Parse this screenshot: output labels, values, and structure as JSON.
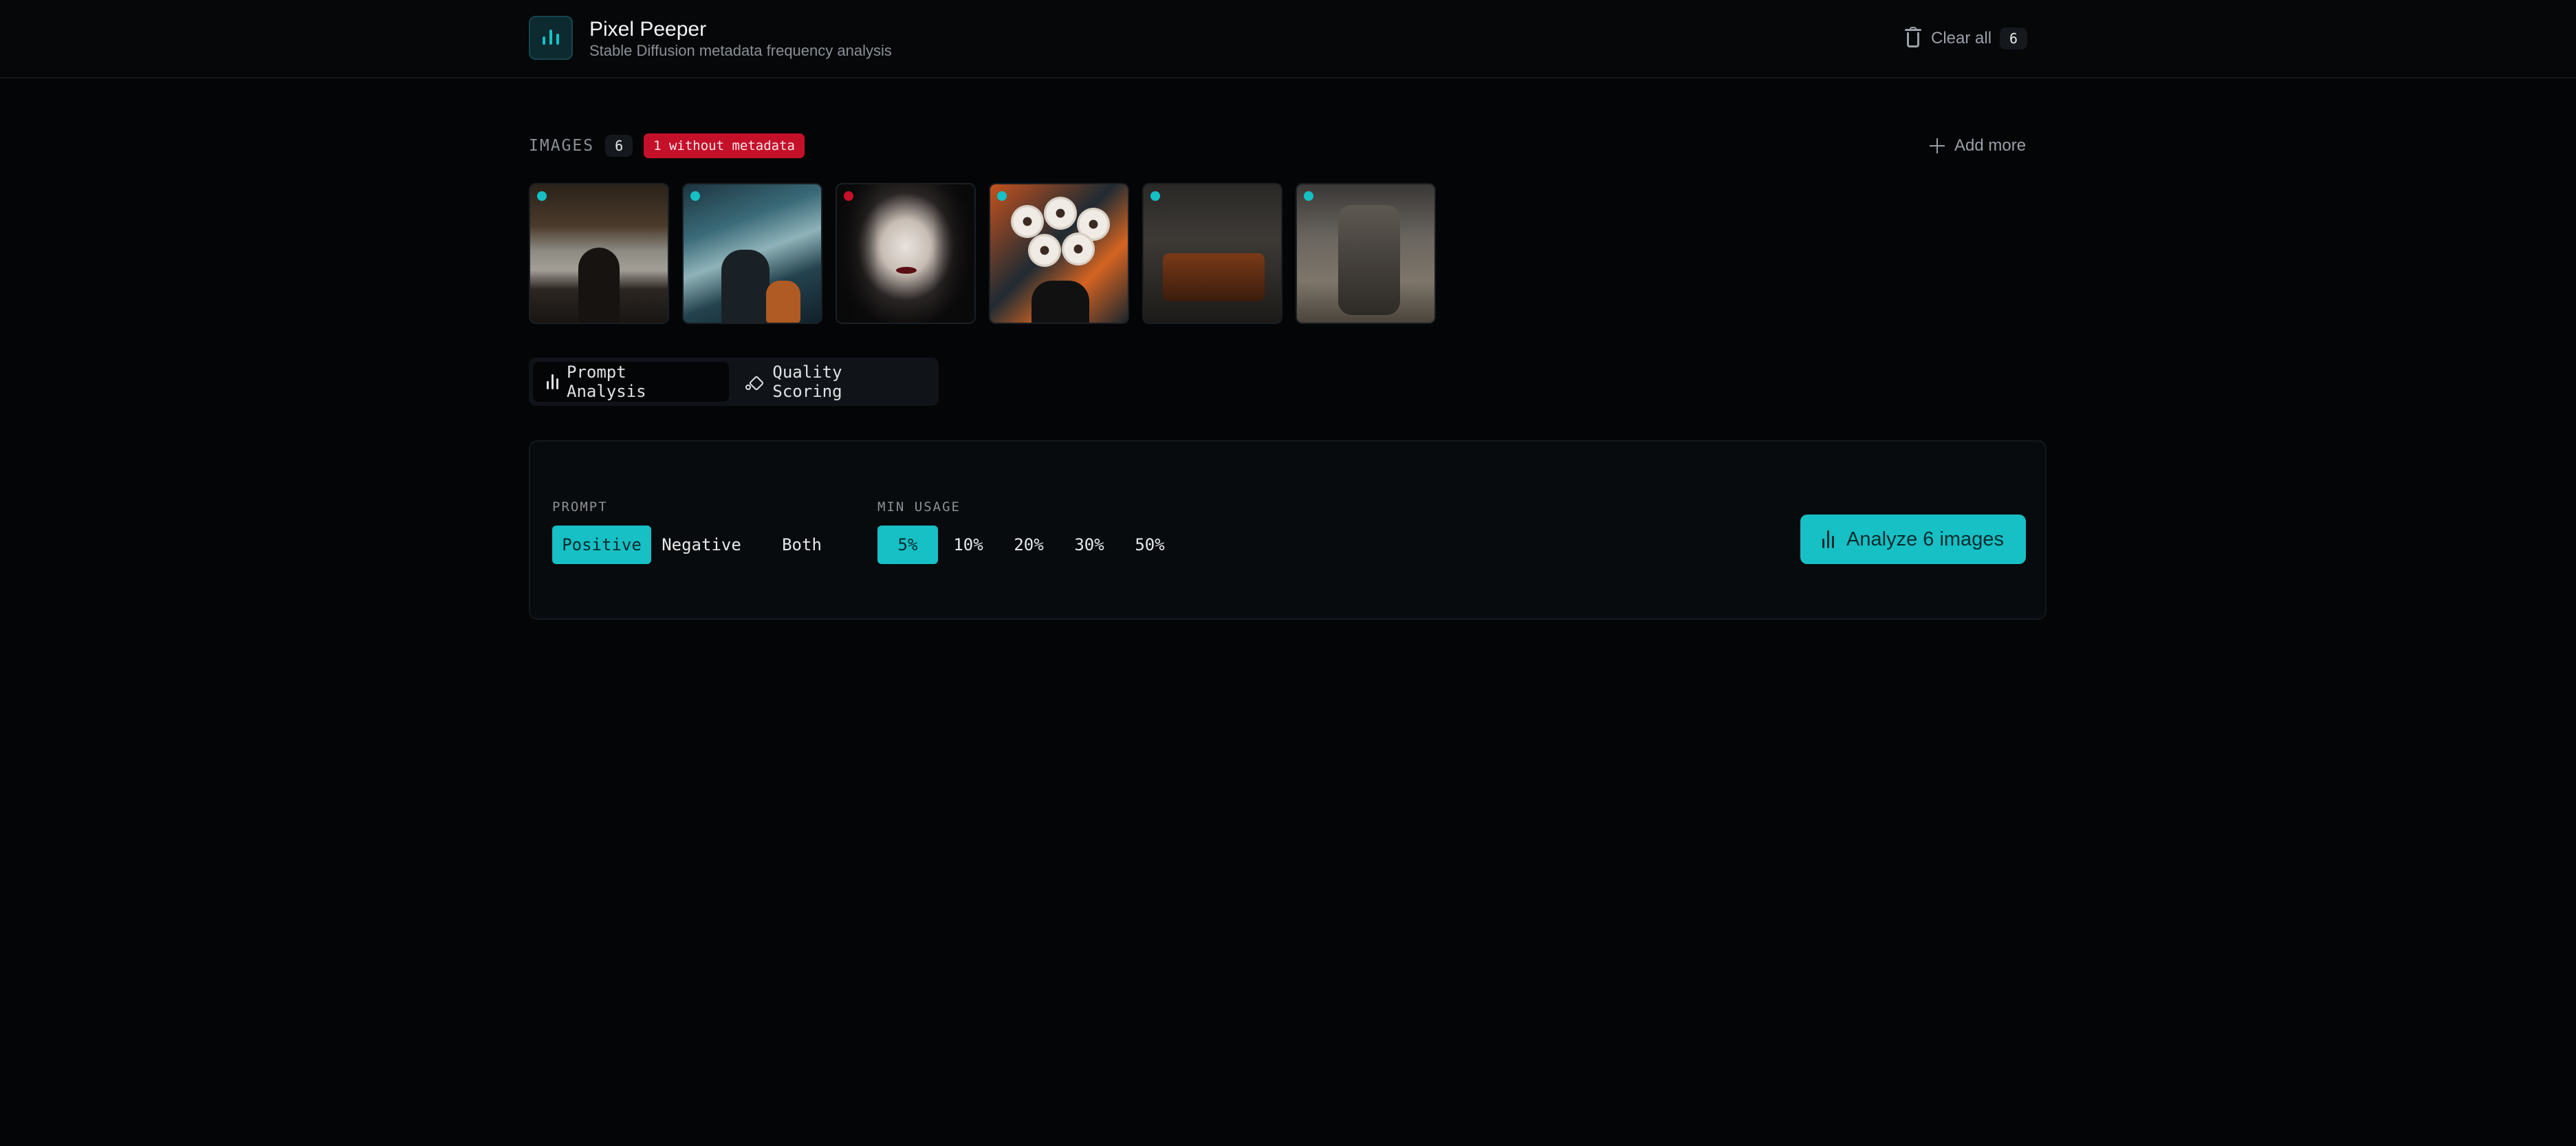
{
  "header": {
    "title": "Pixel Peeper",
    "subtitle": "Stable Diffusion metadata frequency analysis",
    "clear_all_label": "Clear all",
    "clear_all_count": "6"
  },
  "images": {
    "label": "IMAGES",
    "count": "6",
    "without_metadata_badge": "1 without metadata",
    "add_more_label": "Add more",
    "thumbnails": [
      {
        "status": "has-metadata",
        "status_color": "#16c0c5"
      },
      {
        "status": "has-metadata",
        "status_color": "#16c0c5"
      },
      {
        "status": "no-metadata",
        "status_color": "#c5102a"
      },
      {
        "status": "has-metadata",
        "status_color": "#16c0c5"
      },
      {
        "status": "has-metadata",
        "status_color": "#16c0c5"
      },
      {
        "status": "has-metadata",
        "status_color": "#16c0c5"
      }
    ]
  },
  "tabs": [
    {
      "label": "Prompt Analysis",
      "active": true,
      "icon": "bar-chart-icon"
    },
    {
      "label": "Quality Scoring",
      "active": false,
      "icon": "sparkle-icon"
    }
  ],
  "controls": {
    "prompt_label": "PROMPT",
    "prompt_options": [
      "Positive",
      "Negative",
      "Both"
    ],
    "prompt_selected": "Positive",
    "min_usage_label": "MIN USAGE",
    "min_usage_options": [
      "5%",
      "10%",
      "20%",
      "30%",
      "50%"
    ],
    "min_usage_selected": "5%",
    "analyze_label": "Analyze 6 images"
  },
  "colors": {
    "accent": "#16c0c5",
    "danger": "#c5102a",
    "background": "#040507"
  }
}
